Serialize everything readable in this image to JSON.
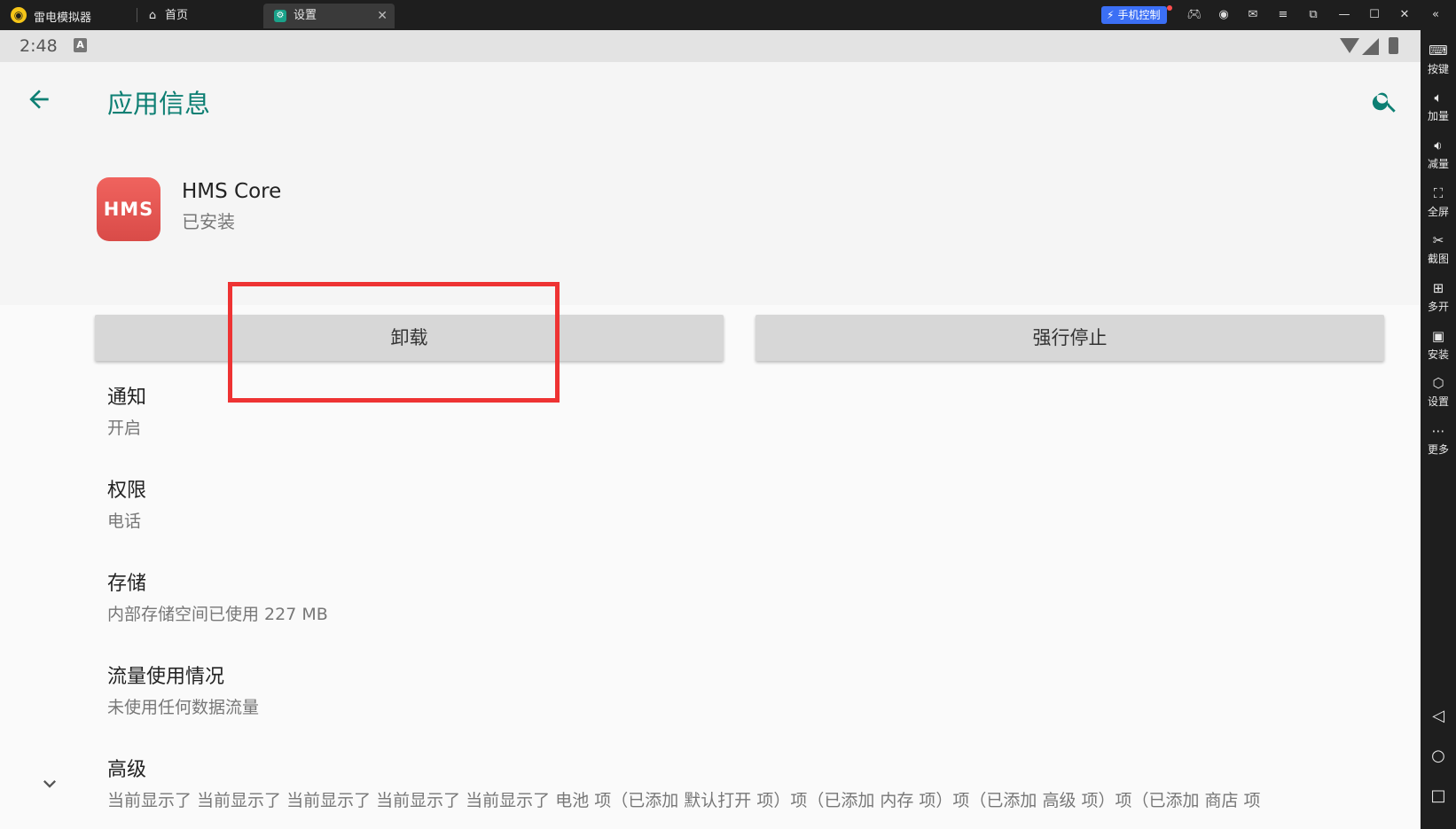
{
  "window": {
    "app_name": "雷电模拟器",
    "tabs": [
      {
        "label": "首页",
        "icon": "home-icon"
      },
      {
        "label": "设置",
        "icon": "gear-icon"
      }
    ],
    "phone_control_label": "手机控制",
    "title_icons": [
      "gamepad-icon",
      "user-icon",
      "mail-icon",
      "menu-icon",
      "restore-icon",
      "minimize-icon",
      "maximize-icon",
      "close-icon",
      "collapse-icon"
    ]
  },
  "statusbar": {
    "time": "2:48",
    "notification_letter": "A"
  },
  "appbar": {
    "title": "应用信息"
  },
  "app": {
    "icon_text": "HMS",
    "name": "HMS Core",
    "status": "已安装"
  },
  "buttons": {
    "uninstall": "卸载",
    "force_stop": "强行停止"
  },
  "prefs": [
    {
      "title": "通知",
      "summary": "开启"
    },
    {
      "title": "权限",
      "summary": "电话"
    },
    {
      "title": "存储",
      "summary": "内部存储空间已使用 227 MB"
    },
    {
      "title": "流量使用情况",
      "summary": "未使用任何数据流量"
    },
    {
      "title": "高级",
      "summary": "当前显示了 当前显示了 当前显示了 当前显示了 当前显示了 电池 项（已添加 默认打开 项）项（已添加 内存 项）项（已添加 高级 项）项（已添加 商店 项"
    }
  ],
  "sidebar": {
    "items": [
      {
        "label": "按键",
        "icon": "keyboard-icon"
      },
      {
        "label": "加量",
        "icon": "volume-up-icon"
      },
      {
        "label": "减量",
        "icon": "volume-down-icon"
      },
      {
        "label": "全屏",
        "icon": "fullscreen-icon"
      },
      {
        "label": "截图",
        "icon": "scissors-icon"
      },
      {
        "label": "多开",
        "icon": "multi-window-icon"
      },
      {
        "label": "安装",
        "icon": "apk-icon"
      },
      {
        "label": "设置",
        "icon": "settings-icon"
      },
      {
        "label": "更多",
        "icon": "more-icon"
      }
    ],
    "nav": [
      "back-triangle-icon",
      "home-circle-icon",
      "recents-square-icon"
    ]
  },
  "colors": {
    "accent": "#0d7f73",
    "highlight_box": "#ee3333",
    "phone_control": "#3b6ff5",
    "hms_icon": "#e35855"
  }
}
